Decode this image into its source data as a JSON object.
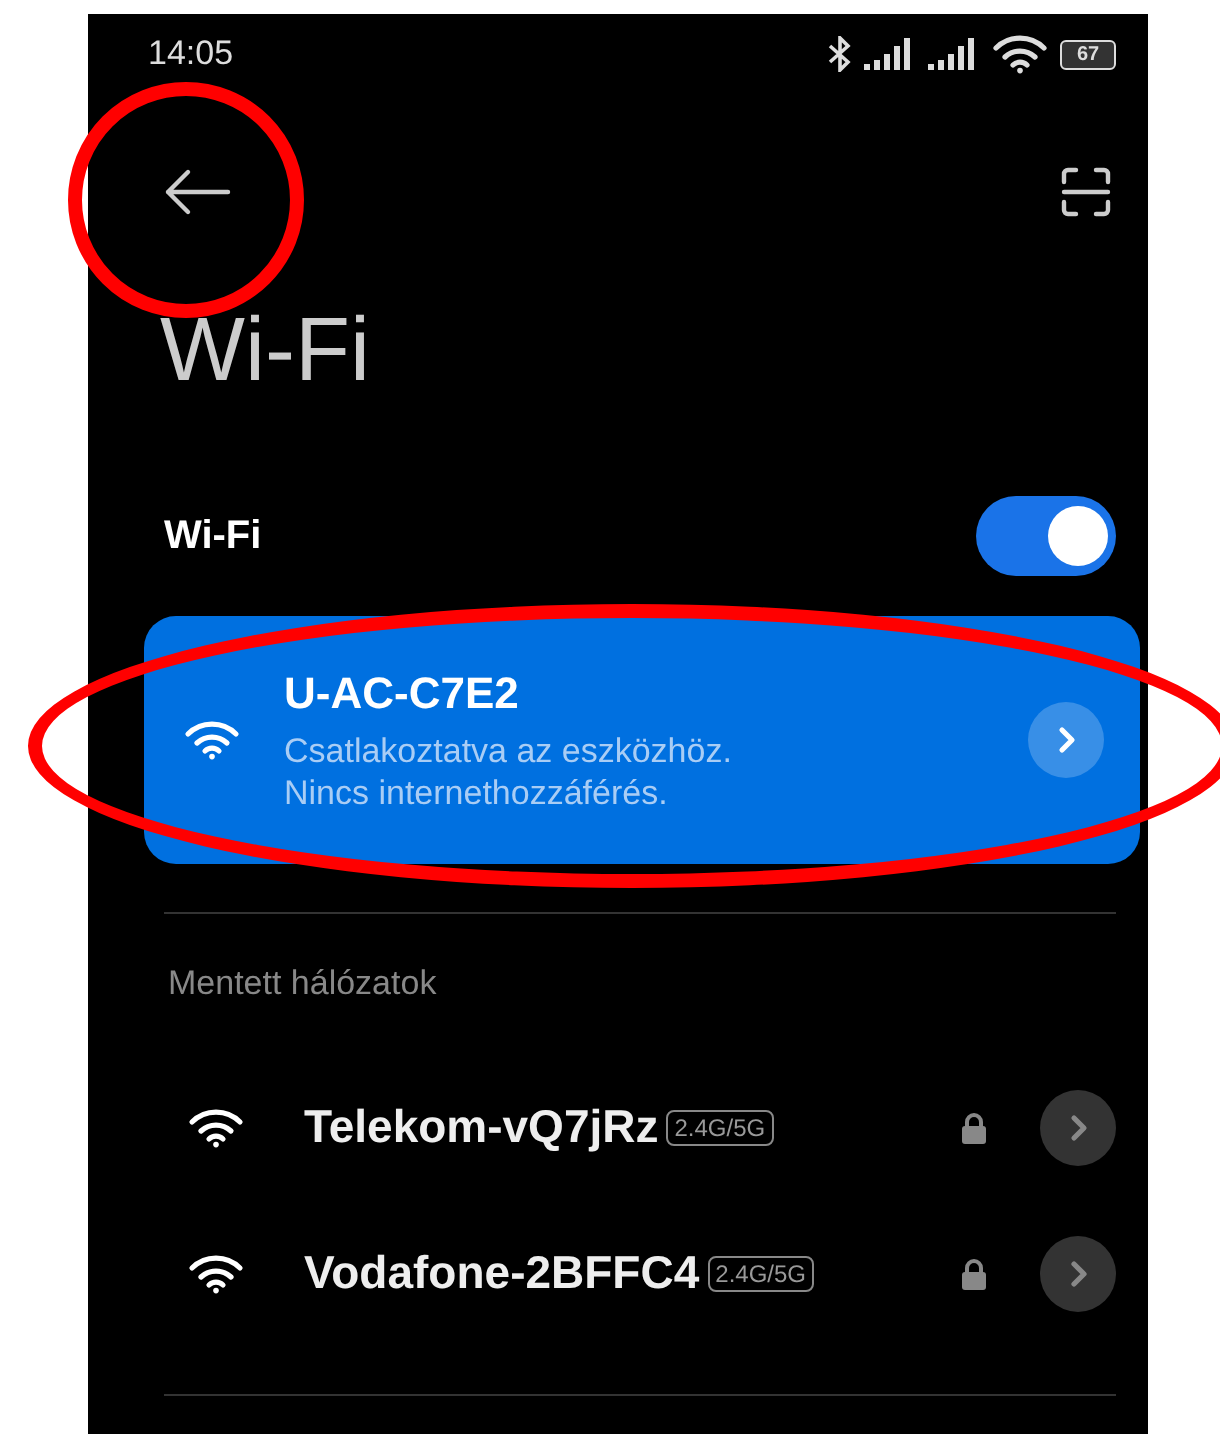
{
  "status_bar": {
    "time": "14:05",
    "battery": "67"
  },
  "toolbar": {
    "back_highlighted": true
  },
  "title": "Wi-Fi",
  "wifi_switch": {
    "label": "Wi-Fi",
    "on": true
  },
  "connected": {
    "name": "U-AC-C7E2",
    "status": "Csatlakoztatva az eszközhöz.",
    "detail": "Nincs internethozzáférés.",
    "highlighted": true
  },
  "saved": {
    "heading": "Mentett hálózatok",
    "networks": [
      {
        "name": "Telekom-vQ7jRz",
        "band": "2.4G/5G",
        "locked": true
      },
      {
        "name": "Vodafone-2BFFC4",
        "band": "2.4G/5G",
        "locked": true
      }
    ]
  }
}
